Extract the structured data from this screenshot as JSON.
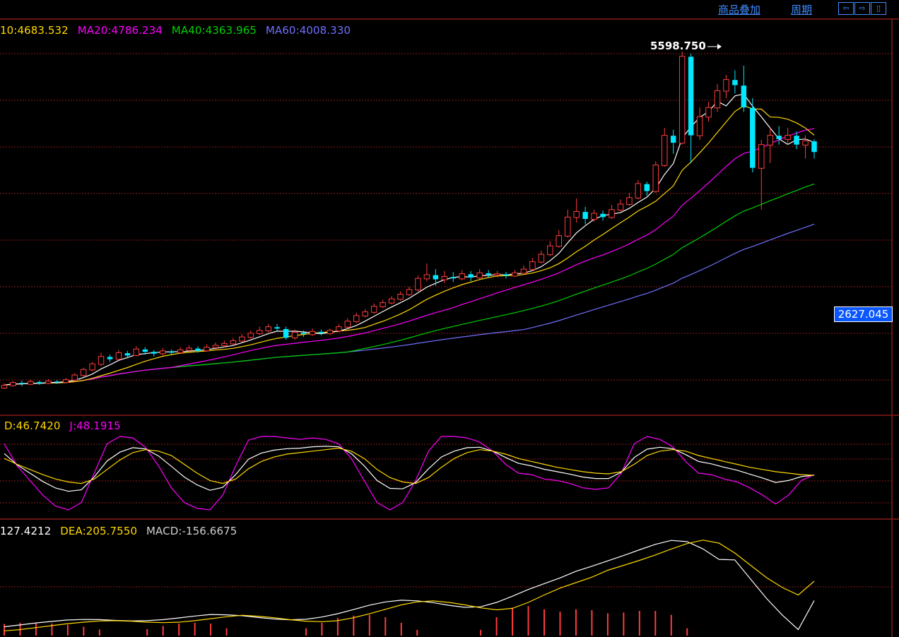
{
  "toolbar": {
    "overlay_label": "商品叠加",
    "period_label": "周期",
    "nav_buttons": [
      "⇦",
      "⇨",
      "▯"
    ]
  },
  "colors": {
    "background": "#000000",
    "grid": "#8b1a1a",
    "candle_up": "#ff3c3c",
    "candle_down": "#00e8ff",
    "ma5": "#ffffff",
    "ma10": "#ffd800",
    "ma20": "#ff00ff",
    "ma40": "#00d000",
    "ma60": "#7070ff",
    "tag_bg": "#0b57ff"
  },
  "main_indicators": [
    {
      "text": "10:4683.532",
      "color": "#ffd800"
    },
    {
      "text": "MA20:4786.234",
      "color": "#ff00ff"
    },
    {
      "text": "MA40:4363.965",
      "color": "#00d000"
    },
    {
      "text": "MA60:4008.330",
      "color": "#7070ff"
    }
  ],
  "kdj_indicators": [
    {
      "text": "D:46.7420",
      "color": "#ffd800"
    },
    {
      "text": "J:48.1915",
      "color": "#ff00ff"
    }
  ],
  "macd_indicators": [
    {
      "text": "127.4212",
      "color": "#ffffff"
    },
    {
      "text": "DEA:205.7550",
      "color": "#ffd800"
    },
    {
      "text": "MACD:-156.6675",
      "color": "#cfcfcf"
    }
  ],
  "peak_label": "5598.750",
  "price_tag": "2627.045",
  "chart_data": [
    {
      "type": "candlestick",
      "panel": "price",
      "peak": 5598.75,
      "marker_value": 2627.045,
      "candles": [
        [
          1980,
          2010,
          1970,
          2030
        ],
        [
          2005,
          2040,
          1995,
          2055
        ],
        [
          2035,
          2025,
          2000,
          2060
        ],
        [
          2020,
          2050,
          2010,
          2070
        ],
        [
          2045,
          2030,
          2015,
          2060
        ],
        [
          2030,
          2055,
          2020,
          2075
        ],
        [
          2050,
          2040,
          2025,
          2065
        ],
        [
          2040,
          2070,
          2030,
          2090
        ],
        [
          2065,
          2120,
          2055,
          2140
        ],
        [
          2115,
          2180,
          2100,
          2200
        ],
        [
          2175,
          2240,
          2160,
          2260
        ],
        [
          2235,
          2320,
          2220,
          2360
        ],
        [
          2315,
          2290,
          2260,
          2340
        ],
        [
          2290,
          2360,
          2280,
          2390
        ],
        [
          2355,
          2330,
          2300,
          2380
        ],
        [
          2330,
          2400,
          2320,
          2430
        ],
        [
          2395,
          2370,
          2340,
          2420
        ],
        [
          2370,
          2350,
          2320,
          2390
        ],
        [
          2350,
          2380,
          2330,
          2410
        ],
        [
          2375,
          2360,
          2335,
          2395
        ],
        [
          2360,
          2390,
          2350,
          2420
        ],
        [
          2385,
          2410,
          2370,
          2440
        ],
        [
          2405,
          2380,
          2360,
          2430
        ],
        [
          2380,
          2420,
          2370,
          2450
        ],
        [
          2415,
          2440,
          2400,
          2470
        ],
        [
          2435,
          2460,
          2420,
          2490
        ],
        [
          2455,
          2490,
          2440,
          2520
        ],
        [
          2485,
          2530,
          2470,
          2560
        ],
        [
          2525,
          2570,
          2510,
          2600
        ],
        [
          2565,
          2600,
          2550,
          2640
        ],
        [
          2595,
          2640,
          2580,
          2670
        ],
        [
          2635,
          2620,
          2590,
          2670
        ],
        [
          2615,
          2520,
          2500,
          2640
        ],
        [
          2520,
          2580,
          2500,
          2610
        ],
        [
          2575,
          2560,
          2530,
          2600
        ],
        [
          2555,
          2590,
          2540,
          2620
        ],
        [
          2585,
          2570,
          2550,
          2610
        ],
        [
          2565,
          2600,
          2550,
          2620
        ],
        [
          2595,
          2640,
          2580,
          2670
        ],
        [
          2635,
          2700,
          2620,
          2730
        ],
        [
          2695,
          2760,
          2680,
          2790
        ],
        [
          2755,
          2800,
          2740,
          2830
        ],
        [
          2795,
          2860,
          2780,
          2890
        ],
        [
          2855,
          2900,
          2840,
          2930
        ],
        [
          2895,
          2940,
          2880,
          2970
        ],
        [
          2935,
          2990,
          2920,
          3020
        ],
        [
          2985,
          3040,
          2970,
          3070
        ],
        [
          3035,
          3160,
          3020,
          3190
        ],
        [
          3155,
          3200,
          3130,
          3320
        ],
        [
          3195,
          3150,
          3080,
          3260
        ],
        [
          3145,
          3180,
          3110,
          3240
        ],
        [
          3175,
          3160,
          3120,
          3230
        ],
        [
          3155,
          3210,
          3140,
          3250
        ],
        [
          3205,
          3170,
          3130,
          3240
        ],
        [
          3165,
          3220,
          3150,
          3260
        ],
        [
          3215,
          3200,
          3170,
          3250
        ],
        [
          3195,
          3210,
          3170,
          3240
        ],
        [
          3205,
          3190,
          3160,
          3230
        ],
        [
          3185,
          3220,
          3175,
          3250
        ],
        [
          3215,
          3260,
          3200,
          3300
        ],
        [
          3255,
          3340,
          3240,
          3380
        ],
        [
          3335,
          3420,
          3320,
          3460
        ],
        [
          3415,
          3510,
          3400,
          3560
        ],
        [
          3505,
          3620,
          3490,
          3680
        ],
        [
          3615,
          3820,
          3600,
          3900
        ],
        [
          3815,
          3880,
          3760,
          4020
        ],
        [
          3875,
          3800,
          3740,
          3930
        ],
        [
          3795,
          3860,
          3770,
          3900
        ],
        [
          3855,
          3820,
          3780,
          3890
        ],
        [
          3815,
          3900,
          3800,
          3950
        ],
        [
          3895,
          3960,
          3880,
          4010
        ],
        [
          3955,
          4030,
          3940,
          4080
        ],
        [
          4025,
          4180,
          4010,
          4220
        ],
        [
          4175,
          4100,
          4050,
          4200
        ],
        [
          4095,
          4380,
          4080,
          4420
        ],
        [
          4375,
          4700,
          4360,
          4780
        ],
        [
          4695,
          4620,
          4500,
          4760
        ],
        [
          4615,
          5550,
          4600,
          5600
        ],
        [
          5545,
          4700,
          4400,
          5580
        ],
        [
          4695,
          4900,
          4650,
          5000
        ],
        [
          4895,
          5000,
          4850,
          5060
        ],
        [
          4995,
          5180,
          4950,
          5250
        ],
        [
          5175,
          5300,
          5100,
          5350
        ],
        [
          5295,
          5240,
          5150,
          5400
        ],
        [
          5235,
          5000,
          4950,
          5450
        ],
        [
          4995,
          4350,
          4300,
          5100
        ],
        [
          4345,
          4600,
          3900,
          4650
        ],
        [
          4595,
          4700,
          4400,
          4780
        ],
        [
          4695,
          4660,
          4600,
          4800
        ],
        [
          4655,
          4700,
          4600,
          4780
        ],
        [
          4695,
          4600,
          4550,
          4740
        ],
        [
          4595,
          4640,
          4450,
          4700
        ],
        [
          4635,
          4520,
          4450,
          4660
        ]
      ]
    },
    {
      "type": "line",
      "panel": "kdj",
      "series": [
        {
          "name": "D",
          "values": [
            70,
            62,
            55,
            48,
            42,
            38,
            36,
            42,
            55,
            68,
            78,
            82,
            80,
            74,
            62,
            50,
            40,
            36,
            42,
            56,
            66,
            72,
            76,
            78,
            80,
            82,
            84,
            80,
            70,
            55,
            44,
            38,
            36,
            44,
            58,
            70,
            78,
            82,
            80,
            76,
            70,
            66,
            62,
            58,
            55,
            52,
            50,
            49,
            52,
            62,
            74,
            80,
            82,
            80,
            74,
            70,
            66,
            62,
            58,
            55,
            52,
            50,
            48,
            47
          ]
        },
        {
          "name": "J",
          "values": [
            90,
            60,
            40,
            20,
            5,
            0,
            10,
            50,
            90,
            100,
            98,
            85,
            60,
            30,
            10,
            2,
            0,
            20,
            60,
            95,
            100,
            100,
            98,
            96,
            98,
            96,
            90,
            70,
            40,
            10,
            0,
            10,
            40,
            80,
            100,
            100,
            98,
            92,
            80,
            62,
            50,
            48,
            42,
            40,
            36,
            30,
            28,
            30,
            50,
            90,
            100,
            96,
            86,
            66,
            50,
            48,
            42,
            38,
            30,
            20,
            8,
            20,
            40,
            48
          ]
        }
      ]
    },
    {
      "type": "line",
      "panel": "macd",
      "series": [
        {
          "name": "DEA",
          "values": [
            5,
            10,
            18,
            26,
            34,
            40,
            45,
            46,
            44,
            40,
            38,
            40,
            46,
            54,
            62,
            68,
            64,
            58,
            50,
            44,
            42,
            46,
            58,
            74,
            92,
            110,
            122,
            126,
            120,
            110,
            98,
            90,
            96,
            120,
            150,
            178,
            200,
            222,
            250,
            270,
            290,
            312,
            336,
            358,
            372,
            360,
            320,
            270,
            220,
            180,
            150,
            205.755
          ]
        }
      ]
    }
  ]
}
